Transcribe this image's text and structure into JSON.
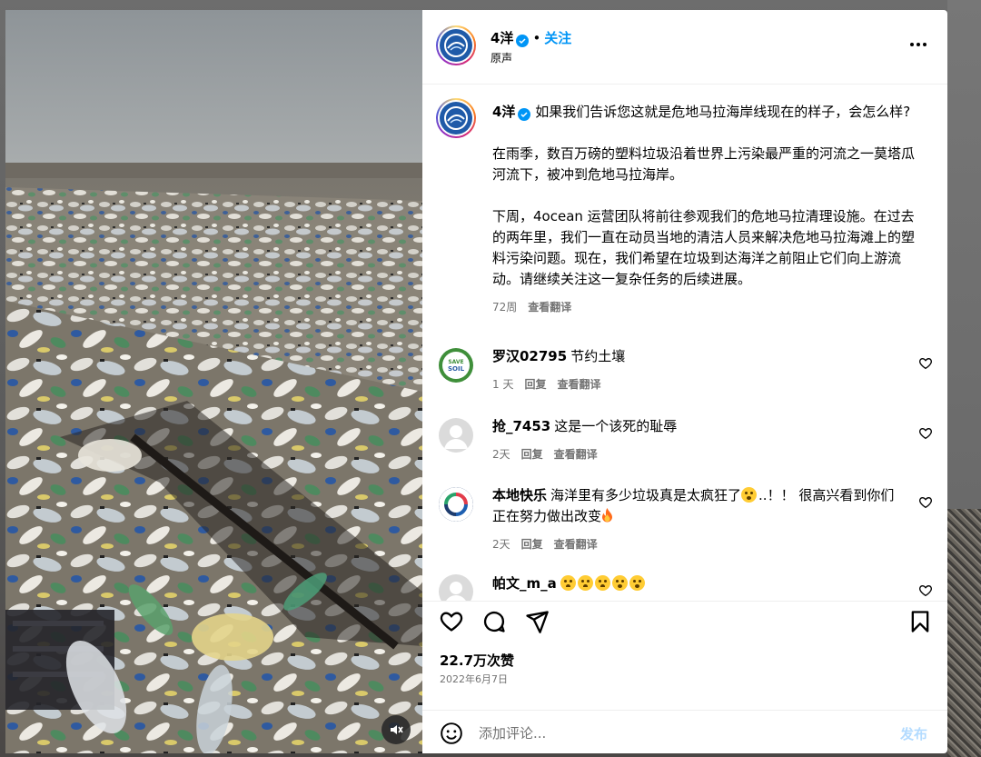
{
  "post": {
    "username": "4洋",
    "follow_label": "关注",
    "audio": "原声",
    "dot": "•"
  },
  "caption": {
    "username": "4洋",
    "line1": "如果我们告诉您这就是危地马拉海岸线现在的样子，会怎么样?",
    "para2": "在雨季，数百万磅的塑料垃圾沿着世界上污染最严重的河流之一莫塔瓜河流下，被冲到危地马拉海岸。",
    "para3": "下周，4ocean 运营团队将前往参观我们的危地马拉清理设施。在过去的两年里，我们一直在动员当地的清洁人员来解决危地马拉海滩上的塑料污染问题。现在，我们希望在垃圾到达海洋之前阻止它们向上游流动。请继续关注这一复杂任务的后续进展。",
    "age": "72周",
    "translate": "查看翻译"
  },
  "comments": [
    {
      "user": "罗汉02795",
      "text": "节约土壤",
      "age": "1 天",
      "reply": "回复",
      "translate": "查看翻译",
      "avatar_text": [
        "SAVE",
        "SOIL"
      ]
    },
    {
      "user": "抢_7453",
      "text": "这是一个该死的耻辱",
      "age": "2天",
      "reply": "回复",
      "translate": "查看翻译"
    },
    {
      "user": "本地快乐",
      "text_a": "海洋里有多少垃圾真是太疯狂了",
      "text_b": "..！！ 很高兴看到你们正在努力做出改变",
      "age": "2天",
      "reply": "回复",
      "translate": "查看翻译"
    },
    {
      "user": "帕文_m_a",
      "text": ""
    }
  ],
  "actions": {
    "likes": "22.7万次赞",
    "date": "2022年6月7日"
  },
  "add_comment": {
    "placeholder": "添加评论...",
    "post_label": "发布"
  },
  "icons": {
    "verified": "verified-badge-icon",
    "more": "more-options-icon",
    "like": "heart-icon",
    "comment": "comment-icon",
    "share": "share-icon",
    "save": "bookmark-icon",
    "emoji": "emoji-icon",
    "mute": "muted-speaker-icon"
  },
  "colors": {
    "accent": "#0095f6",
    "secondary_text": "#737373",
    "post_disabled": "#b3dbff",
    "brand_avatar": "#1f5aa8"
  }
}
